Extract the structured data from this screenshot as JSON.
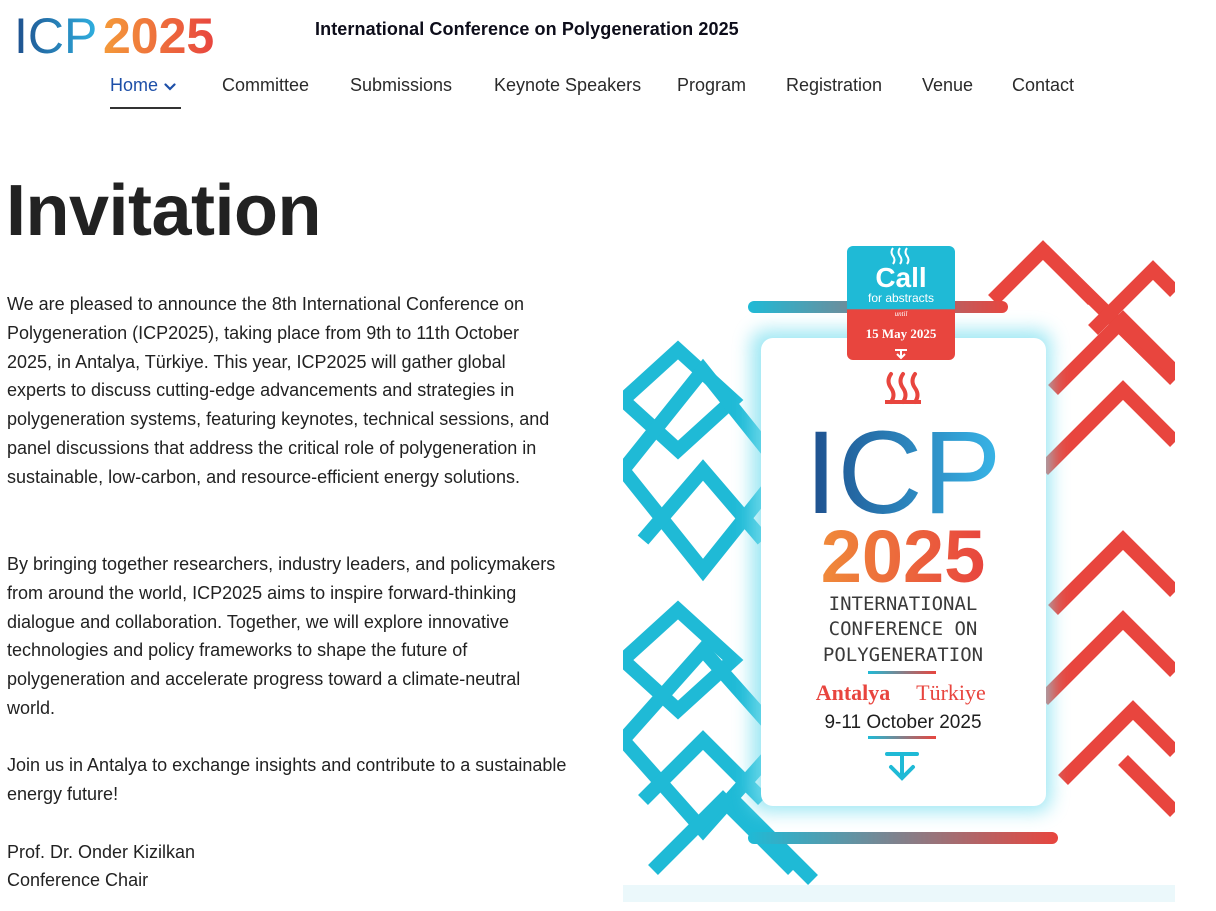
{
  "header": {
    "logo_text": "ICP2025",
    "logo_part1": "ICP",
    "logo_part2": "2025",
    "site_title": "International Conference on Polygeneration 2025"
  },
  "nav": {
    "items": [
      {
        "label": "Home"
      },
      {
        "label": "Committee"
      },
      {
        "label": "Submissions"
      },
      {
        "label": "Keynote Speakers"
      },
      {
        "label": "Program"
      },
      {
        "label": "Registration"
      },
      {
        "label": "Venue"
      },
      {
        "label": "Contact"
      }
    ]
  },
  "main": {
    "heading": "Invitation",
    "paragraphs": [
      "We are pleased to announce the 8th International Conference on Polygeneration (ICP2025), taking place from 9th to 11th October 2025, in Antalya, Türkiye. This year, ICP2025 will gather global experts to discuss cutting-edge advancements and strategies in polygeneration systems, featuring keynotes, technical sessions, and panel discussions that address the critical role of polygeneration in sustainable, low-carbon, and resource-efficient energy solutions.",
      "By bringing together researchers, industry leaders, and policymakers from around the world, ICP2025 aims to inspire forward-thinking dialogue and collaboration. Together, we will explore innovative technologies and policy frameworks to shape the future of polygeneration and accelerate progress toward a climate-neutral world.",
      "Join us in Antalya to exchange insights and contribute to a sustainable energy future!"
    ],
    "signature_name": "Prof. Dr. Onder Kizilkan",
    "signature_role": "Conference Chair"
  },
  "poster": {
    "call_title": "Call",
    "call_sub": "for abstracts",
    "call_until": "until",
    "call_date": "15 May 2025",
    "big_icp": "ICP",
    "big_year": "2025",
    "line1": "INTERNATIONAL",
    "line2": "CONFERENCE ON",
    "line3": "POLYGENERATION",
    "city": "Antalya",
    "country": "Türkiye",
    "dates": "9-11 October 2025"
  },
  "colors": {
    "nav_active": "#1d4fa8",
    "logo_blue": "#2a9bd6",
    "logo_orange": "#f07f3c",
    "poster_cyan": "#1fbad6",
    "poster_red": "#e8453e"
  }
}
